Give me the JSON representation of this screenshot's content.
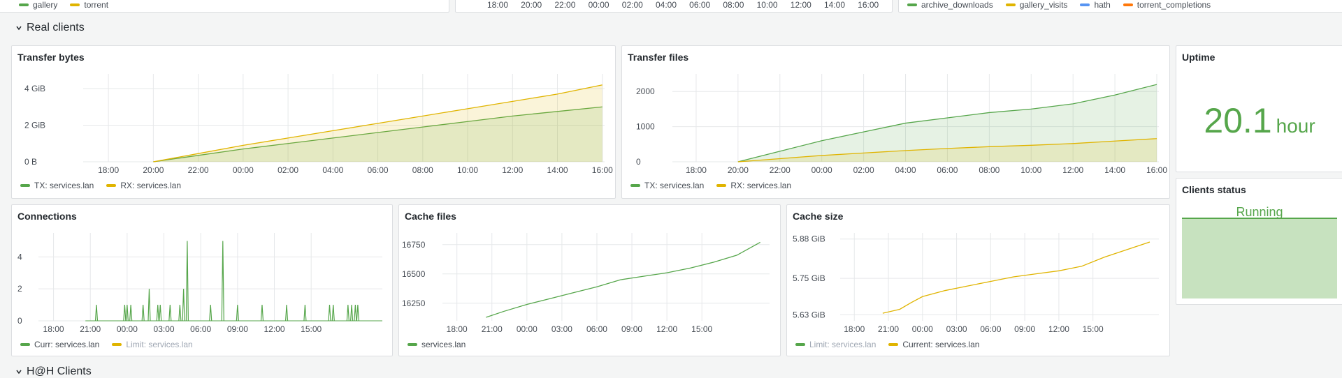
{
  "top_partial": {
    "left_legend": [
      {
        "label": "gallery",
        "color": "#56a64b"
      },
      {
        "label": "torrent",
        "color": "#e0b400"
      }
    ],
    "mid_ticks": [
      "18:00",
      "20:00",
      "22:00",
      "00:00",
      "02:00",
      "04:00",
      "06:00",
      "08:00",
      "10:00",
      "12:00",
      "14:00",
      "16:00"
    ],
    "right_legend": [
      {
        "label": "archive_downloads",
        "color": "#56a64b"
      },
      {
        "label": "gallery_visits",
        "color": "#e0b400"
      },
      {
        "label": "hath",
        "color": "#5794f2"
      },
      {
        "label": "torrent_completions",
        "color": "#ff780a"
      }
    ]
  },
  "rows": {
    "real_clients": {
      "title": "Real clients",
      "chevron": "chevron-down-icon"
    },
    "next_title": "H@H Clients"
  },
  "colors": {
    "green": "#56a64b",
    "yellow": "#e0b400",
    "gray": "#9fa7b3"
  },
  "panels": {
    "transfer_bytes": {
      "title": "Transfer bytes",
      "legend": [
        {
          "label": "TX: services.lan",
          "color": "#56a64b"
        },
        {
          "label": "RX: services.lan",
          "color": "#e0b400"
        }
      ],
      "chart_data": {
        "type": "area",
        "x_ticks": [
          "18:00",
          "20:00",
          "22:00",
          "00:00",
          "02:00",
          "04:00",
          "06:00",
          "08:00",
          "10:00",
          "12:00",
          "14:00",
          "16:00"
        ],
        "y_ticks": [
          "0 B",
          "2 GiB",
          "4 GiB"
        ],
        "ylim": [
          0,
          4.8
        ],
        "x": [
          20,
          22,
          0,
          2,
          4,
          6,
          8,
          10,
          12,
          14,
          16
        ],
        "series": [
          {
            "name": "TX: services.lan",
            "color": "#56a64b",
            "values": [
              0,
              0.35,
              0.7,
              1.0,
              1.3,
              1.6,
              1.9,
              2.2,
              2.5,
              2.75,
              3.0
            ]
          },
          {
            "name": "RX: services.lan",
            "color": "#e0b400",
            "values": [
              0,
              0.45,
              0.9,
              1.3,
              1.7,
              2.1,
              2.5,
              2.9,
              3.3,
              3.7,
              4.2
            ]
          }
        ]
      }
    },
    "transfer_files": {
      "title": "Transfer files",
      "legend": [
        {
          "label": "TX: services.lan",
          "color": "#56a64b"
        },
        {
          "label": "RX: services.lan",
          "color": "#e0b400"
        }
      ],
      "chart_data": {
        "type": "area",
        "x_ticks": [
          "18:00",
          "20:00",
          "22:00",
          "00:00",
          "02:00",
          "04:00",
          "06:00",
          "08:00",
          "10:00",
          "12:00",
          "14:00",
          "16:00"
        ],
        "y_ticks": [
          "0",
          "1000",
          "2000"
        ],
        "ylim": [
          0,
          2500
        ],
        "x": [
          20,
          22,
          0,
          2,
          4,
          6,
          8,
          10,
          12,
          14,
          16
        ],
        "series": [
          {
            "name": "TX: services.lan",
            "color": "#56a64b",
            "values": [
              0,
              300,
              600,
              850,
              1100,
              1250,
              1400,
              1500,
              1650,
              1900,
              2200
            ]
          },
          {
            "name": "RX: services.lan",
            "color": "#e0b400",
            "values": [
              0,
              90,
              180,
              250,
              320,
              380,
              430,
              470,
              520,
              590,
              660
            ]
          }
        ]
      }
    },
    "uptime": {
      "title": "Uptime",
      "value": "20.1",
      "unit": "hour"
    },
    "clients_status": {
      "title": "Clients status",
      "value": "Running"
    },
    "connections": {
      "title": "Connections",
      "legend": [
        {
          "label": "Curr: services.lan",
          "color": "#56a64b",
          "dim": false
        },
        {
          "label": "Limit: services.lan",
          "color": "#e0b400",
          "dim": true
        }
      ],
      "chart_data": {
        "type": "line",
        "x_ticks": [
          "18:00",
          "21:00",
          "00:00",
          "03:00",
          "06:00",
          "09:00",
          "12:00",
          "15:00"
        ],
        "y_ticks": [
          "0",
          "2",
          "4"
        ],
        "ylim": [
          0,
          5.5
        ],
        "series": [
          {
            "name": "Curr: services.lan",
            "color": "#56a64b",
            "spikes": [
              [
                21.5,
                1
              ],
              [
                23.8,
                1
              ],
              [
                24.0,
                1
              ],
              [
                24.3,
                1
              ],
              [
                25.3,
                1
              ],
              [
                25.8,
                2
              ],
              [
                26.5,
                1
              ],
              [
                26.7,
                1
              ],
              [
                27.5,
                1
              ],
              [
                28.3,
                1
              ],
              [
                28.6,
                2
              ],
              [
                28.9,
                5
              ],
              [
                31.8,
                5
              ],
              [
                30.8,
                1
              ],
              [
                33.0,
                1
              ],
              [
                35.0,
                1
              ],
              [
                37.0,
                1
              ],
              [
                38.5,
                1
              ],
              [
                40.5,
                1
              ],
              [
                40.8,
                1
              ],
              [
                42.0,
                1
              ],
              [
                42.3,
                1
              ],
              [
                42.6,
                1
              ],
              [
                42.8,
                1
              ]
            ]
          }
        ]
      }
    },
    "cache_files": {
      "title": "Cache files",
      "legend": [
        {
          "label": "services.lan",
          "color": "#56a64b"
        }
      ],
      "chart_data": {
        "type": "line",
        "x_ticks": [
          "18:00",
          "21:00",
          "00:00",
          "03:00",
          "06:00",
          "09:00",
          "12:00",
          "15:00"
        ],
        "y_ticks": [
          "16250",
          "16500",
          "16750"
        ],
        "ylim": [
          16100,
          16850
        ],
        "x": [
          20.5,
          22,
          24,
          26,
          28,
          30,
          32,
          34,
          36,
          38,
          40,
          42,
          44
        ],
        "series": [
          {
            "name": "services.lan",
            "color": "#56a64b",
            "values": [
              16130,
              16180,
              16240,
              16290,
              16340,
              16390,
              16450,
              16480,
              16510,
              16550,
              16600,
              16660,
              16770
            ]
          }
        ]
      }
    },
    "cache_size": {
      "title": "Cache size",
      "legend": [
        {
          "label": "Limit: services.lan",
          "color": "#56a64b",
          "dim": true
        },
        {
          "label": "Current: services.lan",
          "color": "#e0b400",
          "dim": false
        }
      ],
      "chart_data": {
        "type": "line",
        "x_ticks": [
          "18:00",
          "21:00",
          "00:00",
          "03:00",
          "06:00",
          "09:00",
          "12:00",
          "15:00"
        ],
        "y_ticks": [
          "5.63 GiB",
          "5.75 GiB",
          "5.88 GiB"
        ],
        "ylim": [
          5.61,
          5.9
        ],
        "x": [
          20.5,
          22,
          23,
          24,
          26,
          28,
          30,
          32,
          34,
          36,
          38,
          40,
          42,
          44
        ],
        "series": [
          {
            "name": "Current: services.lan",
            "color": "#e0b400",
            "values": [
              5.635,
              5.648,
              5.67,
              5.69,
              5.71,
              5.725,
              5.74,
              5.755,
              5.765,
              5.775,
              5.79,
              5.82,
              5.845,
              5.87
            ]
          }
        ]
      }
    }
  }
}
